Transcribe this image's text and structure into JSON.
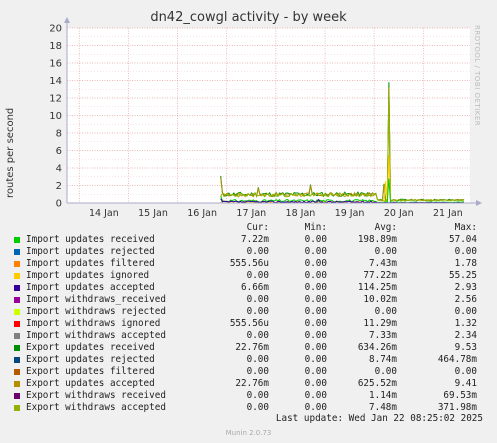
{
  "chart_data": {
    "type": "line",
    "title": "dn42_cowgl activity - by week",
    "ylabel": "routes per second",
    "ylim": [
      0,
      20
    ],
    "yticks": [
      "0",
      "2",
      "4",
      "6",
      "8",
      "10",
      "12",
      "14",
      "16",
      "18",
      "20"
    ],
    "xticks": [
      "14 Jan",
      "15 Jan",
      "16 Jan",
      "17 Jan",
      "18 Jan",
      "19 Jan",
      "20 Jan",
      "21 Jan"
    ],
    "grid": true,
    "columns": [
      "Cur:",
      "Min:",
      "Avg:",
      "Max:"
    ],
    "series": [
      {
        "name": "Import updates received",
        "color": "#00cc00",
        "cur": "7.22m",
        "min": "0.00",
        "avg": "198.89m",
        "max": "57.04"
      },
      {
        "name": "Import updates rejected",
        "color": "#0066b3",
        "cur": "0.00",
        "min": "0.00",
        "avg": "0.00",
        "max": "0.00"
      },
      {
        "name": "Import updates filtered",
        "color": "#ff8000",
        "cur": "555.56u",
        "min": "0.00",
        "avg": "7.43m",
        "max": "1.78"
      },
      {
        "name": "Import updates ignored",
        "color": "#ffcc00",
        "cur": "0.00",
        "min": "0.00",
        "avg": "77.22m",
        "max": "55.25"
      },
      {
        "name": "Import updates accepted",
        "color": "#330099",
        "cur": "6.66m",
        "min": "0.00",
        "avg": "114.25m",
        "max": "2.93"
      },
      {
        "name": "Import withdraws_received",
        "color": "#990099",
        "cur": "0.00",
        "min": "0.00",
        "avg": "10.02m",
        "max": "2.56"
      },
      {
        "name": "Import withdraws rejected",
        "color": "#ccff00",
        "cur": "0.00",
        "min": "0.00",
        "avg": "0.00",
        "max": "0.00"
      },
      {
        "name": "Import withdraws ignored",
        "color": "#ff0000",
        "cur": "555.56u",
        "min": "0.00",
        "avg": "11.29m",
        "max": "1.32"
      },
      {
        "name": "Import withdraws accepted",
        "color": "#808080",
        "cur": "0.00",
        "min": "0.00",
        "avg": "7.33m",
        "max": "2.34"
      },
      {
        "name": "Export updates received",
        "color": "#008f00",
        "cur": "22.76m",
        "min": "0.00",
        "avg": "634.26m",
        "max": "9.53"
      },
      {
        "name": "Export updates rejected",
        "color": "#00487d",
        "cur": "0.00",
        "min": "0.00",
        "avg": "8.74m",
        "max": "464.78m"
      },
      {
        "name": "Export updates filtered",
        "color": "#b35a00",
        "cur": "0.00",
        "min": "0.00",
        "avg": "0.00",
        "max": "0.00"
      },
      {
        "name": "Export updates accepted",
        "color": "#b38f00",
        "cur": "22.76m",
        "min": "0.00",
        "avg": "625.52m",
        "max": "9.41"
      },
      {
        "name": "Export withdraws received",
        "color": "#6b006b",
        "cur": "0.00",
        "min": "0.00",
        "avg": "1.14m",
        "max": "69.53m"
      },
      {
        "name": "Export withdraws accepted",
        "color": "#8fb300",
        "cur": "0.00",
        "min": "0.00",
        "avg": "7.48m",
        "max": "371.98m"
      }
    ]
  },
  "side_text": "RRDTOOL / TOBI OETIKER",
  "last_update": "Last update: Wed Jan 22 08:25:02 2025",
  "version": "Munin 2.0.73"
}
